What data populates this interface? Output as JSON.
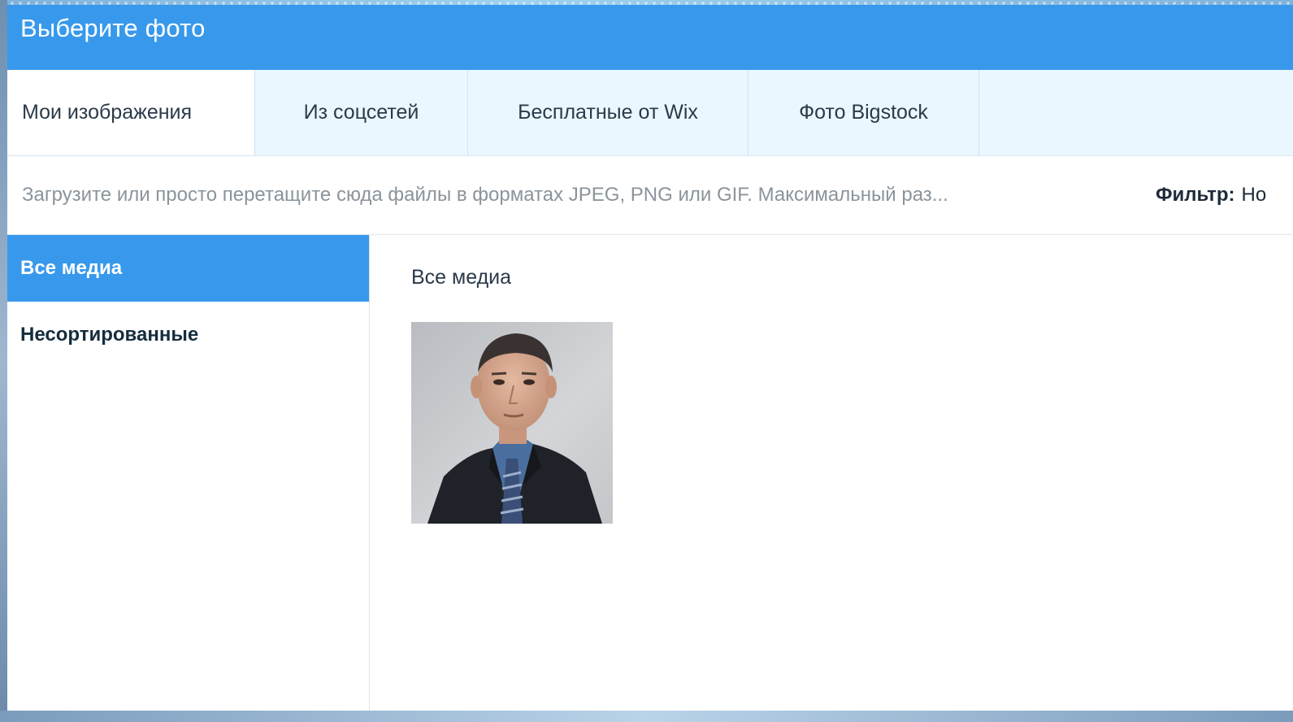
{
  "dialog": {
    "title": "Выберите фото"
  },
  "tabs": [
    {
      "label": "Мои изображения",
      "active": true
    },
    {
      "label": "Из соцсетей",
      "active": false
    },
    {
      "label": "Бесплатные от Wix",
      "active": false
    },
    {
      "label": "Фото Bigstock",
      "active": false
    }
  ],
  "upload": {
    "hint": "Загрузите или просто перетащите сюда файлы в форматах JPEG, PNG или GIF. Максимальный раз...",
    "filter_label": "Фильтр:",
    "filter_value": "Но"
  },
  "sidebar": {
    "items": [
      {
        "label": "Все медиа",
        "active": true
      },
      {
        "label": "Несортированные",
        "active": false
      }
    ]
  },
  "content": {
    "title": "Все медиа",
    "media": [
      {
        "kind": "photo",
        "subject": "portrait-man-in-suit"
      }
    ]
  },
  "colors": {
    "accent": "#3899ec",
    "tab_bg": "#eaf7ff",
    "text_dark": "#162d3d",
    "text_muted": "#8a949c"
  }
}
